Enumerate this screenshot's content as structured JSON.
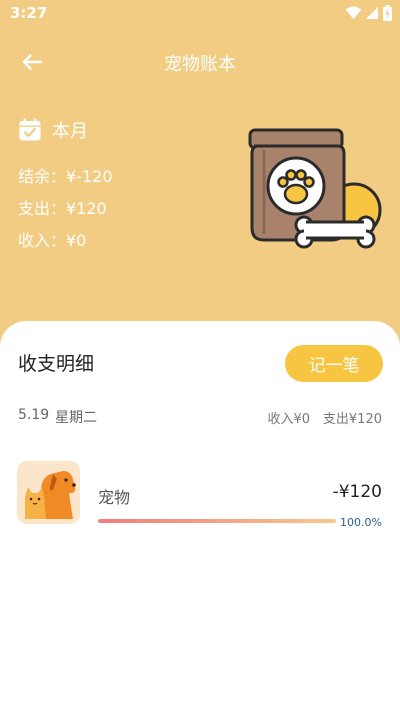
{
  "status_bar": {
    "time": "3:27",
    "icons": [
      "wifi-icon",
      "signal-icon",
      "battery-icon"
    ]
  },
  "header": {
    "title": "宠物账本",
    "back_icon": "arrow-left-icon"
  },
  "summary": {
    "period_icon": "calendar-icon",
    "period": "本月",
    "balance": "结余：¥-120",
    "expense": "支出：¥120",
    "income": "收入：¥0",
    "illustration": "pet-food-bag-with-bone"
  },
  "details": {
    "title": "收支明细",
    "add_button": "记一笔",
    "day": {
      "date": "5.19",
      "weekday": "星期二",
      "income": "收入¥0",
      "expense": "支出¥120"
    },
    "records": [
      {
        "icon": "dog-and-cat-icon",
        "category": "宠物",
        "amount": "-¥120",
        "percent_label": "100.0%",
        "percent": 100
      }
    ]
  },
  "colors": {
    "background": "#f2cc82",
    "accent_button": "#f7c542",
    "progress_start": "#f07d7d",
    "progress_end": "#f8c98a",
    "percent_text": "#2a5d8f"
  }
}
